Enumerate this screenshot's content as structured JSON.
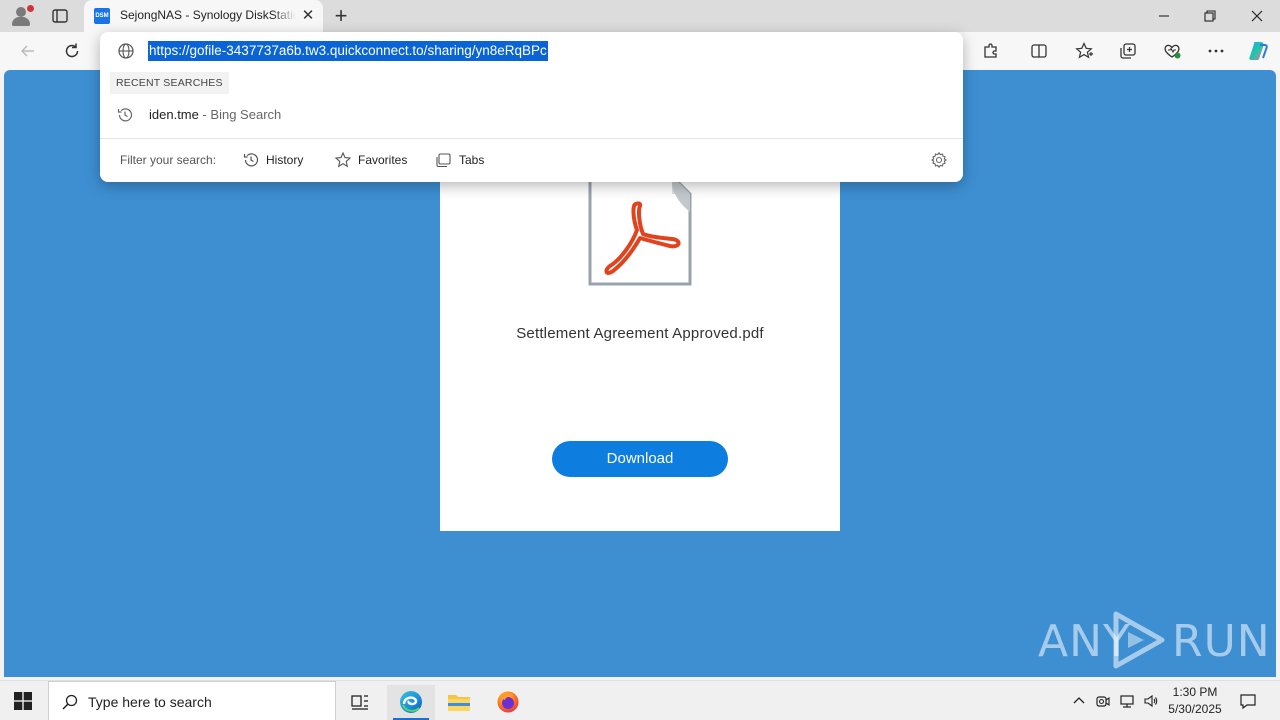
{
  "browser": {
    "tab": {
      "favicon_text": "DSM",
      "title": "SejongNAS - Synology DiskStation"
    },
    "address": {
      "url": "https://gofile-3437737a6b.tw3.quickconnect.to/sharing/yn8eRqBPc"
    },
    "omnibox": {
      "recent_label": "RECENT SEARCHES",
      "suggestion_main": "iden.tme",
      "suggestion_sub": " - Bing Search",
      "filter_label": "Filter your search:",
      "filters": [
        "History",
        "Favorites",
        "Tabs"
      ]
    }
  },
  "page": {
    "filename": "Settlement Agreement Approved.pdf",
    "download_label": "Download",
    "watermark_left": "ANY",
    "watermark_right": "RUN",
    "colors": {
      "background": "#3d8fd2",
      "button": "#0d7de0",
      "pdf_red": "#e1431f"
    }
  },
  "taskbar": {
    "search_placeholder": "Type here to search",
    "time": "1:30 PM",
    "date": "5/30/2025"
  }
}
